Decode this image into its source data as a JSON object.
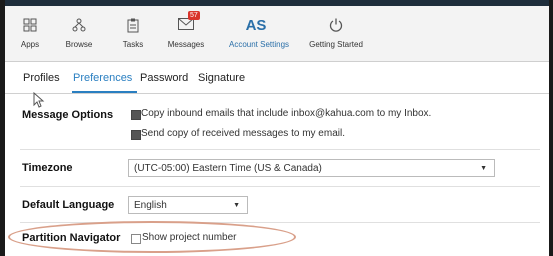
{
  "toolbar": {
    "items": [
      {
        "label": "Apps",
        "icon": "apps-grid-icon"
      },
      {
        "label": "Browse",
        "icon": "browse-tree-icon"
      },
      {
        "label": "Tasks",
        "icon": "tasks-clipboard-icon"
      },
      {
        "label": "Messages",
        "icon": "envelope-icon",
        "badge": "57"
      },
      {
        "label": "Account Settings",
        "initials": "AS"
      },
      {
        "label": "Getting Started",
        "icon": "power-icon"
      }
    ]
  },
  "tabs": [
    "Profiles",
    "Preferences",
    "Password",
    "Signature"
  ],
  "active_tab": "Preferences",
  "message_options": {
    "label": "Message Options",
    "option1": "Copy inbound emails that include inbox@kahua.com to my Inbox.",
    "option2": "Send copy of received messages to my email."
  },
  "timezone": {
    "label": "Timezone",
    "value": "(UTC-05:00) Eastern Time (US & Canada)"
  },
  "language": {
    "label": "Default Language",
    "value": "English"
  },
  "partition": {
    "label": "Partition Navigator",
    "option": "Show project number"
  },
  "colors": {
    "accent": "#2a7fc1",
    "badge": "#d9342b",
    "highlight_oval": "#d9a08a"
  }
}
